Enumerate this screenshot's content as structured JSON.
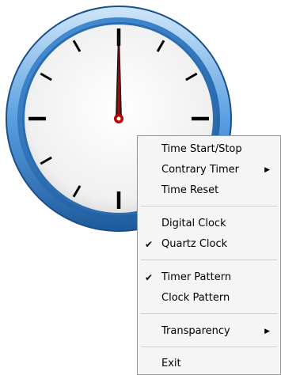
{
  "clock": {
    "time_display": "12:00",
    "colors": {
      "bezel_outer": "#1f5fa3",
      "bezel_mid": "#4a92d8",
      "bezel_light": "#9ccaf0",
      "face": "#f0f0f0",
      "ticks": "#000000",
      "hands": "#111111",
      "second_hand": "#c00000"
    }
  },
  "context_menu": {
    "items": [
      {
        "label": "Time Start/Stop",
        "checked": false,
        "submenu": false
      },
      {
        "label": "Contrary Timer",
        "checked": false,
        "submenu": true
      },
      {
        "label": "Time Reset",
        "checked": false,
        "submenu": false
      },
      {
        "label": "Digital Clock",
        "checked": false,
        "submenu": false
      },
      {
        "label": "Quartz Clock",
        "checked": true,
        "submenu": false
      },
      {
        "label": "Timer Pattern",
        "checked": true,
        "submenu": false
      },
      {
        "label": "Clock Pattern",
        "checked": false,
        "submenu": false
      },
      {
        "label": "Transparency",
        "checked": false,
        "submenu": true
      },
      {
        "label": "Exit",
        "checked": false,
        "submenu": false
      }
    ],
    "check_glyph": "✔",
    "arrow_glyph": "▶"
  }
}
